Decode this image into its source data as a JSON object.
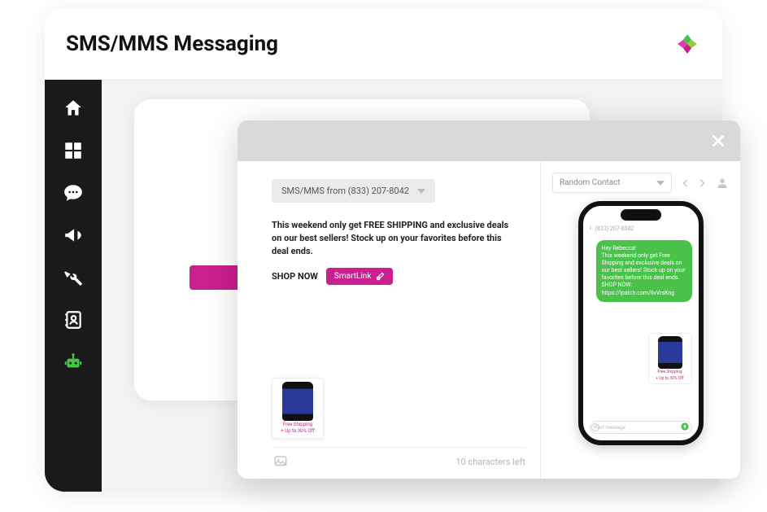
{
  "header": {
    "title": "SMS/MMS Messaging"
  },
  "sidebar": {
    "items": [
      {
        "name": "home"
      },
      {
        "name": "apps"
      },
      {
        "name": "chat"
      },
      {
        "name": "campaigns"
      },
      {
        "name": "tools"
      },
      {
        "name": "contacts"
      },
      {
        "name": "bot"
      }
    ]
  },
  "compose": {
    "from_label": "SMS/MMS from (833) 207-8042",
    "message": "This weekend only get FREE SHIPPING and exclusive deals on our best sellers! Stock up on your favorites before this deal ends.",
    "shop_label": "SHOP NOW",
    "smartlink_label": "SmartLink",
    "chars_left": "10 characters left",
    "product": {
      "caption_line1": "Free Shipping",
      "caption_line2": "+ Up to 30% Off"
    }
  },
  "preview": {
    "contact_label": "Random Contact",
    "phone_number": "(833) 207-8042",
    "sms_text": "Hey Rebecca!\nThis weekend only get Free Shipping and exclusive deals on our best sellers! Stock up on your favorites before this deal ends.\nSHOP NOW:\nhttps://lpatch.com/livVrsKng",
    "input_placeholder": "Text message"
  }
}
